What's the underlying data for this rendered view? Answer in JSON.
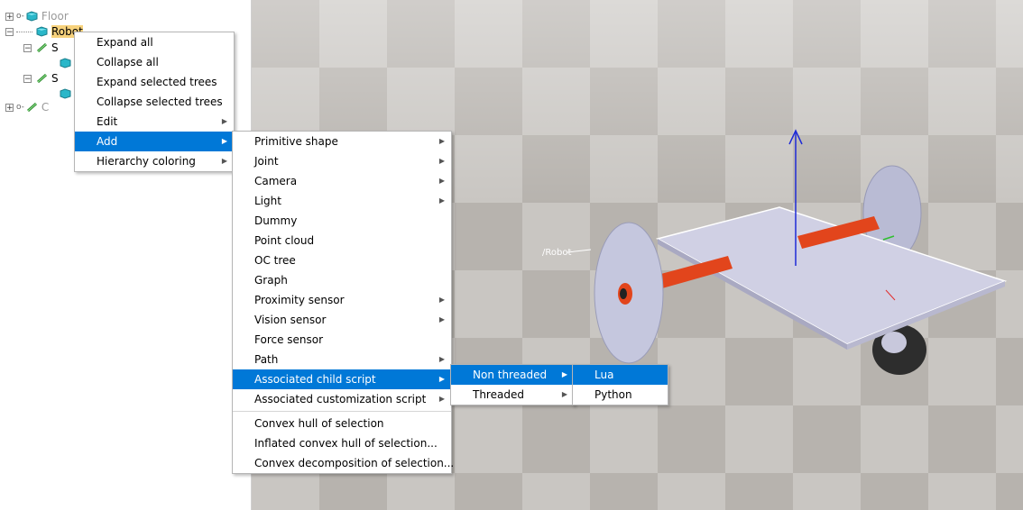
{
  "tree": {
    "items": [
      {
        "label": "Floor"
      },
      {
        "label": "Robot"
      },
      {
        "label": "S"
      },
      {
        "label": "S"
      },
      {
        "label": "C"
      }
    ]
  },
  "viewport": {
    "object_label": "/Robot"
  },
  "context_menu": {
    "items": [
      {
        "label": "Expand all"
      },
      {
        "label": "Collapse all"
      },
      {
        "label": "Expand selected trees"
      },
      {
        "label": "Collapse selected trees"
      },
      {
        "label": "Edit"
      },
      {
        "label": "Add"
      },
      {
        "label": "Hierarchy coloring"
      }
    ]
  },
  "add_menu": {
    "items": [
      {
        "label": "Primitive shape"
      },
      {
        "label": "Joint"
      },
      {
        "label": "Camera"
      },
      {
        "label": "Light"
      },
      {
        "label": "Dummy"
      },
      {
        "label": "Point cloud"
      },
      {
        "label": "OC tree"
      },
      {
        "label": "Graph"
      },
      {
        "label": "Proximity sensor"
      },
      {
        "label": "Vision sensor"
      },
      {
        "label": "Force sensor"
      },
      {
        "label": "Path"
      },
      {
        "label": "Associated child script"
      },
      {
        "label": "Associated customization script"
      },
      {
        "label": "Convex hull of selection"
      },
      {
        "label": "Inflated convex hull of selection..."
      },
      {
        "label": "Convex decomposition of selection..."
      }
    ]
  },
  "child_script_menu": {
    "items": [
      {
        "label": "Non threaded"
      },
      {
        "label": "Threaded"
      }
    ]
  },
  "language_menu": {
    "items": [
      {
        "label": "Lua"
      },
      {
        "label": "Python"
      }
    ]
  },
  "colors": {
    "highlight": "#0078d7",
    "tree_selection": "#f7d27c",
    "platform": "#c8c8dc",
    "axle": "#e2451c",
    "axis_arrow": "#1f2bd6"
  },
  "icons": [
    "plus-expander-icon",
    "minus-expander-icon",
    "shape-cube-icon",
    "joint-icon",
    "submenu-arrow-icon"
  ]
}
